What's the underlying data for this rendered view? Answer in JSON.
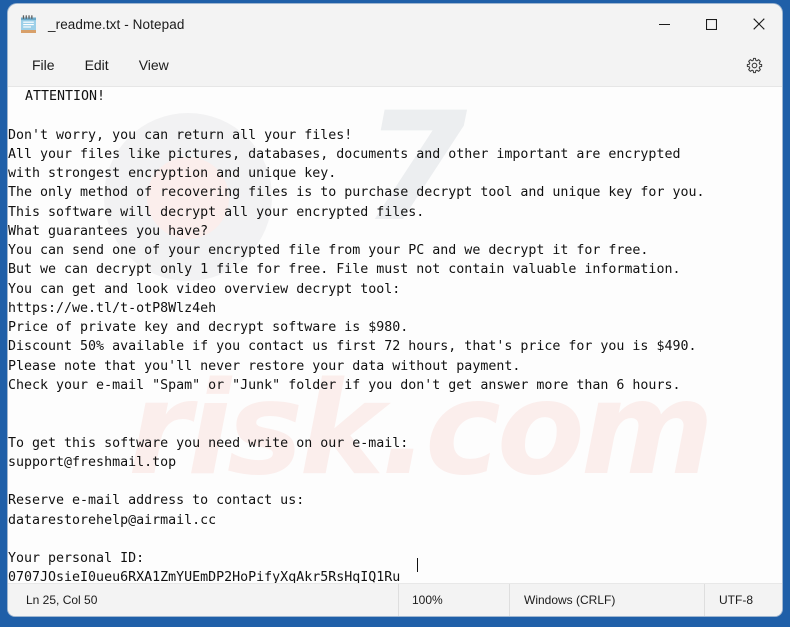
{
  "window": {
    "title": "_readme.txt - Notepad",
    "icon": "notepad-icon",
    "controls": {
      "minimize": "—",
      "maximize": "□",
      "close": "✕"
    }
  },
  "menu": {
    "items": [
      {
        "label": "File"
      },
      {
        "label": "Edit"
      },
      {
        "label": "View"
      }
    ],
    "settings_icon": "gear-icon"
  },
  "watermark": {
    "top": "7",
    "bottom": "risk.com"
  },
  "document": {
    "text": "ATTENTION!\n\nDon't worry, you can return all your files!\nAll your files like pictures, databases, documents and other important are encrypted\nwith strongest encryption and unique key.\nThe only method of recovering files is to purchase decrypt tool and unique key for you.\nThis software will decrypt all your encrypted files.\nWhat guarantees you have?\nYou can send one of your encrypted file from your PC and we decrypt it for free.\nBut we can decrypt only 1 file for free. File must not contain valuable information.\nYou can get and look video overview decrypt tool:\nhttps://we.tl/t-otP8Wlz4eh\nPrice of private key and decrypt software is $980.\nDiscount 50% available if you contact us first 72 hours, that's price for you is $490.\nPlease note that you'll never restore your data without payment.\nCheck your e-mail \"Spam\" or \"Junk\" folder if you don't get answer more than 6 hours.\n\n\nTo get this software you need write on our e-mail:\nsupport@freshmail.top\n\nReserve e-mail address to contact us:\ndatarestorehelp@airmail.cc\n\nYour personal ID:\n0707JOsieI0ueu6RXA1ZmYUEmDP2HoPifyXqAkr5RsHqIQ1Ru"
  },
  "status_bar": {
    "position": "Ln 25, Col 50",
    "zoom": "100%",
    "line_ending": "Windows (CRLF)",
    "encoding": "UTF-8"
  },
  "colors": {
    "frame": "#1f5fa8",
    "chrome": "#f3f3f3",
    "editor_background": "#fdfdfd",
    "text": "#111111"
  }
}
